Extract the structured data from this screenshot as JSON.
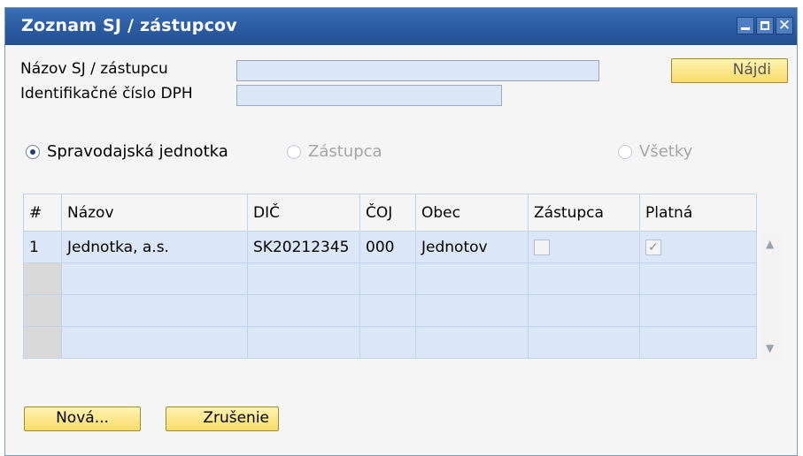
{
  "window": {
    "title": "Zoznam SJ / zástupcov",
    "close_glyph": "✕"
  },
  "form": {
    "name_label": "Názov SJ / zástupcu",
    "name_value": "",
    "vat_label": "Identifikačné číslo DPH",
    "vat_value": "",
    "find_button": "Nájdi"
  },
  "radios": {
    "unit": "Spravodajská jednotka",
    "representative": "Zástupca",
    "all": "Všetky",
    "selected": "unit"
  },
  "table": {
    "headers": [
      "#",
      "Názov",
      "DIČ",
      "ČOJ",
      "Obec",
      "Zástupca",
      "Platná"
    ],
    "rows": [
      {
        "num": "1",
        "name": "Jednotka, a.s.",
        "dic": "SK20212345",
        "coj": "000",
        "town": "Jednotov",
        "representative": false,
        "valid": true
      }
    ]
  },
  "buttons": {
    "new": "Nová...",
    "cancel": "Zrušenie"
  },
  "colors": {
    "title_bar": "#2a5aa0",
    "field_bg": "#dbe6f7",
    "button_bg": "#f7dc6a"
  }
}
